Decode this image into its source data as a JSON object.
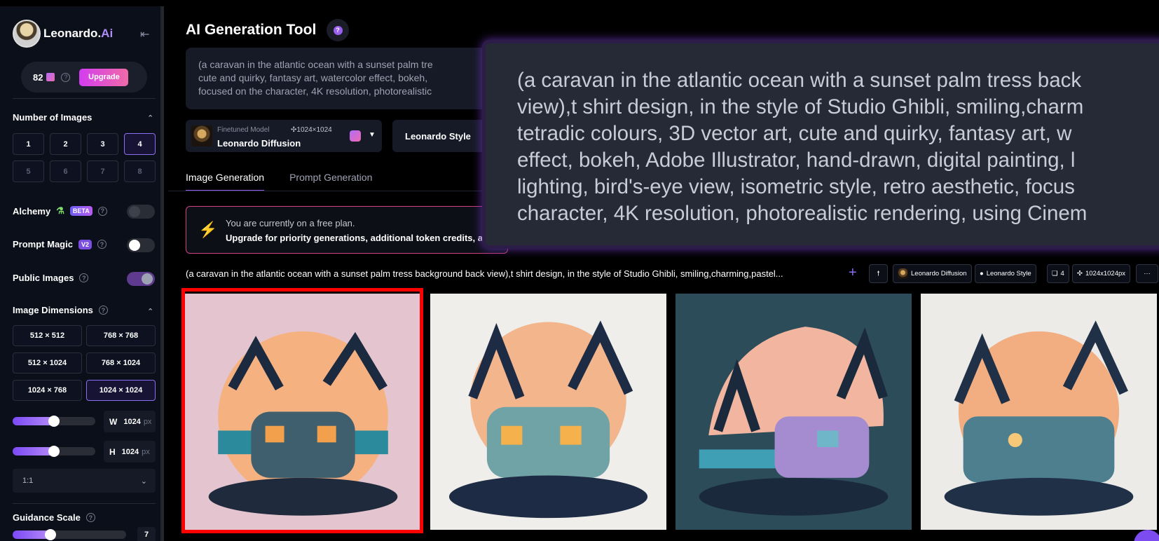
{
  "app": {
    "brand": "Leonardo.",
    "brand_ai": "Ai",
    "credits": "82",
    "upgrade_label": "Upgrade"
  },
  "sidebar": {
    "num_images": {
      "title": "Number of Images",
      "options": [
        "1",
        "2",
        "3",
        "4",
        "5",
        "6",
        "7",
        "8"
      ],
      "selected": "4"
    },
    "alchemy": {
      "label": "Alchemy",
      "badge": "BETA",
      "enabled": false
    },
    "prompt_magic": {
      "label": "Prompt Magic",
      "badge": "V2",
      "enabled": false
    },
    "public_images": {
      "label": "Public Images",
      "enabled": true
    },
    "dimensions": {
      "title": "Image Dimensions",
      "options": [
        "512 × 512",
        "768 × 768",
        "512 × 1024",
        "768 × 1024",
        "1024 × 768",
        "1024 × 1024"
      ],
      "selected": "1024 × 1024",
      "width_label": "W",
      "width_value": "1024",
      "height_label": "H",
      "height_value": "1024",
      "unit": "px",
      "width_slider_fraction": 0.5,
      "height_slider_fraction": 0.5,
      "aspect_ratio": "1:1"
    },
    "guidance": {
      "title": "Guidance Scale",
      "value": "7",
      "slider_fraction": 0.33
    }
  },
  "main": {
    "title": "AI Generation Tool",
    "prompt_lines": [
      "(a caravan in the atlantic ocean with a sunset  palm tre",
      "cute and quirky, fantasy art, watercolor effect, bokeh,",
      "focused on the character, 4K resolution, photorealistic"
    ],
    "model": {
      "label": "Finetuned Model",
      "resolution": "1024×1024",
      "name": "Leonardo Diffusion"
    },
    "style": "Leonardo Style",
    "tabs": [
      "Image Generation",
      "Prompt Generation"
    ],
    "active_tab": "Image Generation",
    "free_plan": {
      "line1": "You are currently on a free plan.",
      "line2": "Upgrade for priority generations, additional token credits, a"
    },
    "generation": {
      "prompt": "(a caravan in the atlantic ocean with a sunset palm tress background back view),t shirt design, in the style of Studio Ghibli, smiling,charming,pastel...",
      "chips": {
        "model": "Leonardo Diffusion",
        "style": "Leonardo Style",
        "count": "4",
        "size": "1024x1024px",
        "more": "···"
      }
    }
  },
  "tooltip": {
    "lines": [
      "(a caravan in the atlantic ocean with a sunset  palm tress back",
      "view),t shirt design, in the style of Studio Ghibli, smiling,charm",
      "tetradic colours, 3D vector art, cute and quirky, fantasy art, w",
      "effect, bokeh, Adobe Illustrator, hand-drawn, digital painting, l",
      "lighting, bird's-eye view, isometric style, retro aesthetic, focus",
      "character, 4K resolution, photorealistic rendering, using Cinem"
    ]
  },
  "colors": {
    "accent": "#8e5ff2",
    "upgrade_gradient_start": "#d33df0",
    "upgrade_gradient_end": "#f06aa7",
    "selection_outline": "#ff0000",
    "panel_bg": "#0b0f19"
  }
}
